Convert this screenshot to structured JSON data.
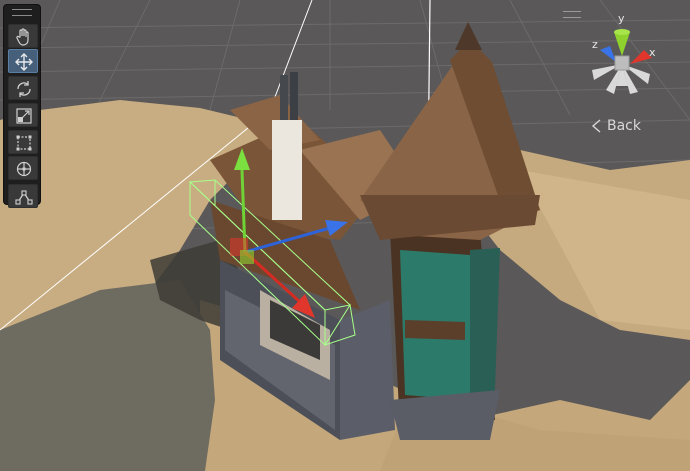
{
  "toolbar": {
    "tools": [
      {
        "name": "hand-tool",
        "icon": "hand-icon",
        "active": false
      },
      {
        "name": "move-tool",
        "icon": "move-arrows-icon",
        "active": true
      },
      {
        "name": "rotate-tool",
        "icon": "rotate-icon",
        "active": false
      },
      {
        "name": "scale-tool",
        "icon": "scale-icon",
        "active": false
      },
      {
        "name": "rect-tool",
        "icon": "rect-transform-icon",
        "active": false
      },
      {
        "name": "transform-tool",
        "icon": "transform-icon",
        "active": false
      },
      {
        "name": "custom-tool",
        "icon": "custom-editor-tool-icon",
        "active": false
      }
    ]
  },
  "gizmo": {
    "axis_labels": {
      "y": "y",
      "x": "x",
      "z": "z"
    },
    "colors": {
      "x": "#e0362b",
      "y": "#8fd22e",
      "z": "#3a73e8",
      "neutral": "#d9d9d9"
    }
  },
  "back_view": {
    "label": "Back",
    "icon": "chevron-left-icon"
  },
  "scene": {
    "colors": {
      "sky": "#5a5858",
      "grid_line": "#6c6a6a",
      "sand": "#c9ad82",
      "rock": "#6e6b61",
      "roof": "#7a5538",
      "glass": "#2c7a6a",
      "stone": "#5a5d66",
      "selection_box": "#a7ff8a"
    }
  }
}
